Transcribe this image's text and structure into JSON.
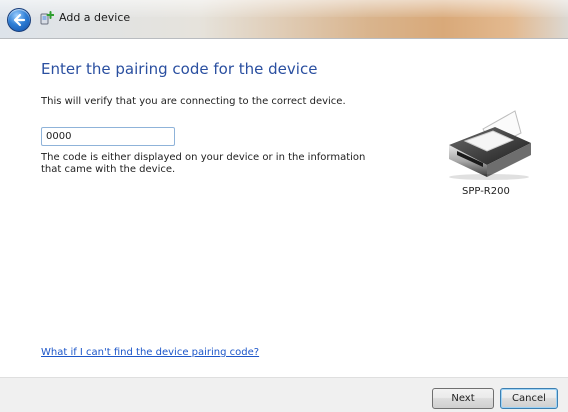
{
  "window": {
    "title": "Add a device",
    "colors": {
      "heading": "#2a4fa0",
      "link": "#1c56c9",
      "footer": "#f0f0f0"
    }
  },
  "main": {
    "heading": "Enter the pairing code for the device",
    "description": "This will verify that you are connecting to the correct device.",
    "code_input": {
      "value": "0000"
    },
    "hint": "The code is either displayed on your device or in the information that came with the device.",
    "device": {
      "name": "SPP-R200",
      "icon": "printer-icon"
    },
    "help_link": "What if I can't find the device pairing code?"
  },
  "footer": {
    "next_label": "Next",
    "cancel_label": "Cancel"
  }
}
